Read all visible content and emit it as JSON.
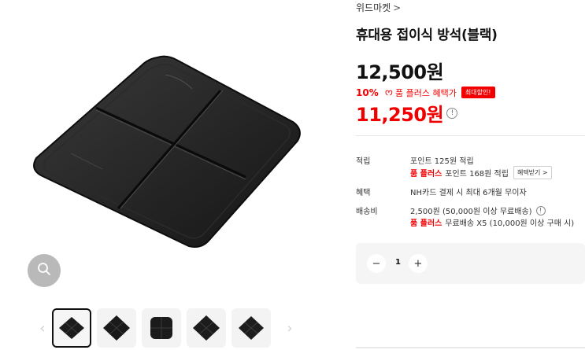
{
  "gallery": {
    "main_image_icon": "black-seat-cushion-image",
    "zoom_icon": "search-icon",
    "thumbnails": [
      {
        "icon": "cushion-thumbnail",
        "active": true
      },
      {
        "icon": "cushion-thumbnail",
        "active": false
      },
      {
        "icon": "cushion-thumbnail",
        "active": false
      },
      {
        "icon": "cushion-thumbnail",
        "active": false
      },
      {
        "icon": "cushion-thumbnail",
        "active": false
      }
    ],
    "prev_arrow": "‹",
    "next_arrow": "›"
  },
  "product": {
    "store_name": "위드마켓",
    "store_chevron": ">",
    "title": "휴대용 접이식 방석(블랙)",
    "original_price": "12,500원",
    "discount_rate": "10%",
    "plus_icon": "ᰔ",
    "benefit_text": "품 플러스 혜택가",
    "badge": "최대할인!",
    "final_price": "11,250원",
    "info_glyph": "!"
  },
  "details": {
    "points_label": "적립",
    "points_value": "포인트 125원 적립",
    "points_plus_brand": "품 플러스",
    "points_plus_value": "포인트 168원 적립",
    "points_button": "혜택받기 >",
    "benefit_label": "혜택",
    "benefit_value": "NH카드 결제 시 최대 6개월 무이자",
    "shipping_label": "배송비",
    "shipping_value": "2,500원 (50,000원 이상 무료배송)",
    "shipping_plus_brand": "품 플러스",
    "shipping_plus_value": "무료배송 X5 (10,000원 이상 구매 시)"
  },
  "quantity": {
    "minus": "−",
    "value": "1",
    "plus": "+"
  },
  "colors": {
    "accent_red": "#f20000",
    "zoom_button": "#b9b9b9",
    "qty_background": "#f5f5f5"
  }
}
